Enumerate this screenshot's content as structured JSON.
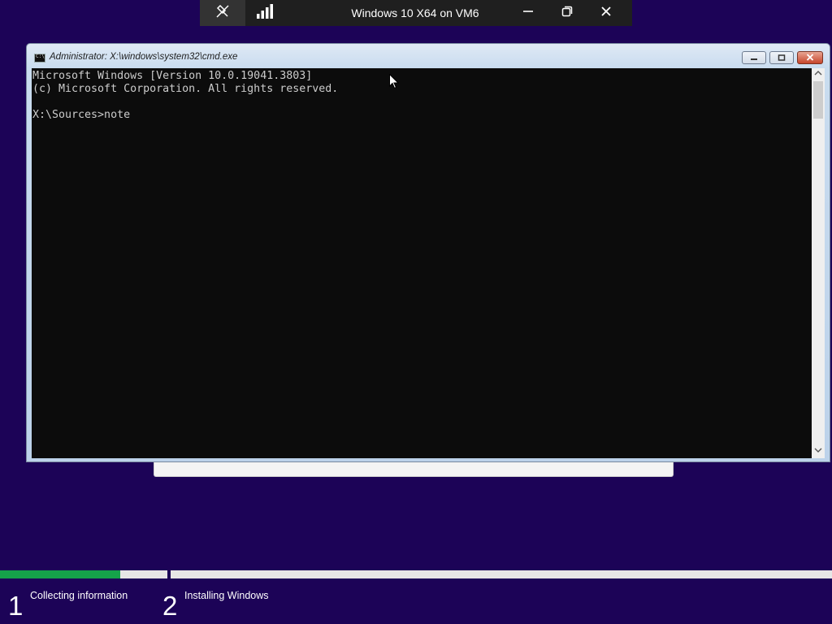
{
  "vm_bar": {
    "title": "Windows 10 X64 on VM6",
    "icons": [
      "unpin-icon",
      "signal-bars-icon",
      "minimize-icon",
      "restore-icon",
      "close-icon"
    ]
  },
  "cmd_window": {
    "title": "Administrator: X:\\windows\\system32\\cmd.exe",
    "console_lines": [
      "Microsoft Windows [Version 10.0.19041.3803]",
      "(c) Microsoft Corporation. All rights reserved.",
      "",
      "X:\\Sources>note"
    ]
  },
  "setup": {
    "progress_fraction": 0.72,
    "steps": [
      {
        "number": "1",
        "label": "Collecting information"
      },
      {
        "number": "2",
        "label": "Installing Windows"
      }
    ]
  },
  "colors": {
    "desktop_background": "#1c0357",
    "progress_fill": "#15a34a",
    "console_background": "#0c0c0c",
    "console_text": "#cccccc"
  }
}
